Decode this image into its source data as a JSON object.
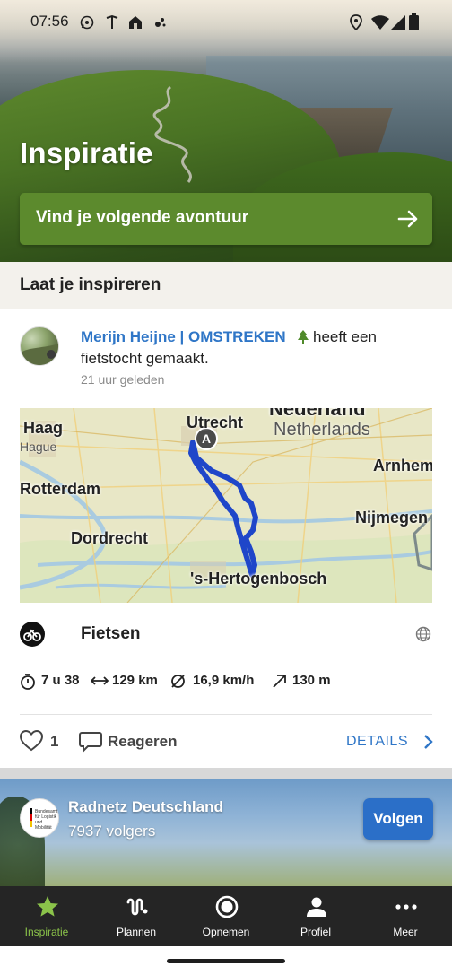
{
  "status_bar": {
    "time": "07:56"
  },
  "hero": {
    "title": "Inspiratie",
    "cta_label": "Vind je volgende avontuur"
  },
  "feed": {
    "section_title": "Laat je inspireren",
    "post": {
      "author": "Merijn Heijne | OMSTREKEN",
      "action_line1": "heeft een",
      "action_line2": "fietstocht gemaakt.",
      "time": "21 uur geleden",
      "map": {
        "labels": {
          "haag": "Haag",
          "hague": "Hague",
          "utrecht": "Utrecht",
          "nederland": "Nederland",
          "netherlands": "Netherlands",
          "arnhem": "Arnhem",
          "rotterdam": "Rotterdam",
          "nijmegen": "Nijmegen",
          "dordrecht": "Dordrecht",
          "hertogenbosch": "'s-Hertogenbosch"
        },
        "start_marker": "A",
        "route_color": "#1f46c9"
      },
      "activity": "Fietsen",
      "stats": {
        "duration": "7 u 38",
        "distance": "129 km",
        "speed": "16,9 km/h",
        "elevation": "130 m"
      },
      "likes": "1",
      "comment_label": "Reageren",
      "details_label": "DETAILS"
    },
    "organization": {
      "name": "Radnetz Deutschland",
      "followers": "7937 volgers",
      "logo_text": "Bundesamt für Logistik und Mobilität",
      "follow_label": "Volgen"
    }
  },
  "bottom_nav": {
    "items": [
      {
        "label": "Inspiratie",
        "icon": "star-icon",
        "active": true
      },
      {
        "label": "Plannen",
        "icon": "route-icon",
        "active": false
      },
      {
        "label": "Opnemen",
        "icon": "record-icon",
        "active": false
      },
      {
        "label": "Profiel",
        "icon": "person-icon",
        "active": false
      },
      {
        "label": "Meer",
        "icon": "more-icon",
        "active": false
      }
    ]
  },
  "colors": {
    "primary_green": "#5c8a2d",
    "active_nav": "#8bc34a",
    "link_blue": "#2f76c7",
    "follow_blue": "#2b6fc8"
  }
}
